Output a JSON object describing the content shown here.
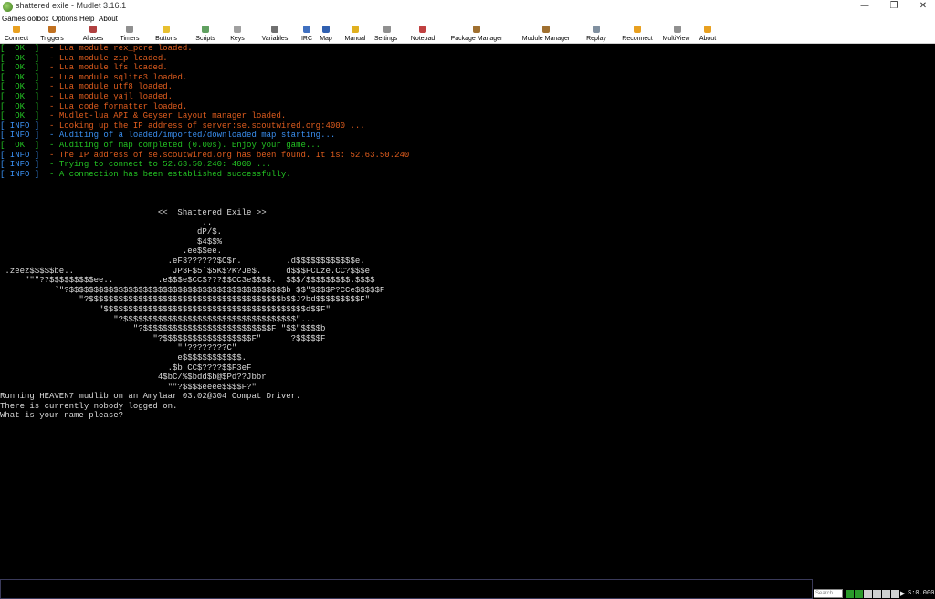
{
  "window": {
    "title": "shattered exile - Mudlet 3.16.1",
    "minimize_glyph": "—",
    "maximize_glyph": "❐",
    "close_glyph": "✕"
  },
  "menu": [
    "Games",
    "Toolbox",
    "Options",
    "Help",
    "About"
  ],
  "toolbar": [
    {
      "label": "Connect",
      "icon": "connect-icon",
      "color": "#e8a020"
    },
    {
      "label": "Triggers",
      "icon": "triggers-icon",
      "color": "#c07020"
    },
    {
      "label": "Aliases",
      "icon": "aliases-icon",
      "color": "#b04040"
    },
    {
      "label": "Timers",
      "icon": "timers-icon",
      "color": "#909090"
    },
    {
      "label": "Buttons",
      "icon": "buttons-icon",
      "color": "#e8c030"
    },
    {
      "label": "Scripts",
      "icon": "scripts-icon",
      "color": "#60a060"
    },
    {
      "label": "Keys",
      "icon": "keys-icon",
      "color": "#a0a0a0"
    },
    {
      "label": "Variables",
      "icon": "variables-icon",
      "color": "#707070"
    },
    {
      "label": "IRC",
      "icon": "irc-icon",
      "color": "#4070c0"
    },
    {
      "label": "Map",
      "icon": "map-icon",
      "color": "#3060b0"
    },
    {
      "label": "Manual",
      "icon": "manual-icon",
      "color": "#e0b020"
    },
    {
      "label": "Settings",
      "icon": "settings-icon",
      "color": "#909090"
    },
    {
      "label": "Notepad",
      "icon": "notepad-icon",
      "color": "#c04040"
    },
    {
      "label": "Package Manager",
      "icon": "package-manager-icon",
      "color": "#a07030"
    },
    {
      "label": "Module Manager",
      "icon": "module-manager-icon",
      "color": "#a07030"
    },
    {
      "label": "Replay",
      "icon": "replay-icon",
      "color": "#8090a0"
    },
    {
      "label": "Reconnect",
      "icon": "reconnect-icon",
      "color": "#e8a020"
    },
    {
      "label": "MultiView",
      "icon": "multiview-icon",
      "color": "#909090"
    },
    {
      "label": "About",
      "icon": "about-icon",
      "color": "#e8a020"
    }
  ],
  "log": [
    {
      "tag": "[  OK  ]",
      "kind": "ok",
      "text": "  - Lua module rex_pcre loaded."
    },
    {
      "tag": "[  OK  ]",
      "kind": "ok",
      "text": "  - Lua module zip loaded."
    },
    {
      "tag": "[  OK  ]",
      "kind": "ok",
      "text": "  - Lua module lfs loaded."
    },
    {
      "tag": "[  OK  ]",
      "kind": "ok",
      "text": "  - Lua module sqlite3 loaded."
    },
    {
      "tag": "[  OK  ]",
      "kind": "ok",
      "text": "  - Lua module utf8 loaded."
    },
    {
      "tag": "[  OK  ]",
      "kind": "ok",
      "text": "  - Lua module yajl loaded."
    },
    {
      "tag": "[  OK  ]",
      "kind": "ok",
      "text": "  - Lua code formatter loaded."
    },
    {
      "tag": "[  OK  ]",
      "kind": "ok",
      "text": "  - Mudlet-lua API & Geyser Layout manager loaded."
    },
    {
      "tag": "[ INFO ]",
      "kind": "info",
      "text": "  - Looking up the IP address of server:se.scoutwired.org:4000 ..."
    },
    {
      "tag": "[ INFO ]",
      "kind": "info",
      "text": "  - Auditing of a loaded/imported/downloaded map starting..."
    },
    {
      "tag": "[  OK  ]",
      "kind": "ok",
      "text": "  - Auditing of map completed (0.00s). Enjoy your game..."
    },
    {
      "tag": "[ INFO ]",
      "kind": "info",
      "text": "  - The IP address of se.scoutwired.org has been found. It is: 52.63.50.240"
    },
    {
      "tag": "[ INFO ]",
      "kind": "info",
      "text": "  - Trying to connect to 52.63.50.240: 4000 ..."
    },
    {
      "tag": "[ INFO ]",
      "kind": "info",
      "text": "  - A connection has been established successfully."
    }
  ],
  "art": [
    "                                <<  Shattered Exile >>",
    "                                         ..",
    "                                        dP/$.",
    "                                        $4$$%",
    "                                     .ee$$ee.",
    "                                  .eF3??????$C$r.         .d$$$$$$$$$$$$e.",
    " .zeez$$$$$be..                    JP3F$5`$5K$?K?Je$.     d$$$FCLze.CC?$$$e",
    "     \"\"\"??$$$$$$$$$ee..         .e$$$e$CC$???$$CC3e$$$$.  $$$/$$$$$$$$$.$$$$",
    "           `\"?$$$$$$$$$$$$$$$$$$$$$$$$$$$$$$$$$$$$$$$$$$$$b $$\"$$$$P?CCe$$$$$F",
    "                \"?$$$$$$$$$$$$$$$$$$$$$$$$$$$$$$$$$$$$$$$b$$J?bd$$$$$$$$$F\"",
    "                    \"$$$$$$$$$$$$$$$$$$$$$$$$$$$$$$$$$$$$$$$$$d$$F\"",
    "                       \"?$$$$$$$$$$$$$$$$$$$$$$$$$$$$$$$$$$$\"...",
    "                           \"?$$$$$$$$$$$$$$$$$$$$$$$$$$F \"$$\"$$$$b",
    "                               \"?$$$$$$$$$$$$$$$$$$F\"      ?$$$$$F",
    "                                    \"\"????????C\"",
    "                                    e$$$$$$$$$$$$.",
    "                                  .$b CC$????$$F3eF",
    "                                4$bC/%$bdd$b@$Pd??Jbbr",
    "                                  \"\"?$$$$eeee$$$$F?\""
  ],
  "server_lines": [
    "Running HEAVEN7 mudlib on an Amylaar 03.02@304 Compat Driver.",
    "There is currently nobody logged on.",
    "What is your name please?"
  ],
  "input": {
    "value": "",
    "placeholder": ""
  },
  "search": {
    "placeholder": "Search ..."
  },
  "status": {
    "timer": "S:0.000"
  },
  "colors": {
    "ok": "#23c123",
    "info": "#3a8ff0",
    "orange": "#e05d1e",
    "text": "#d8d8d8"
  }
}
